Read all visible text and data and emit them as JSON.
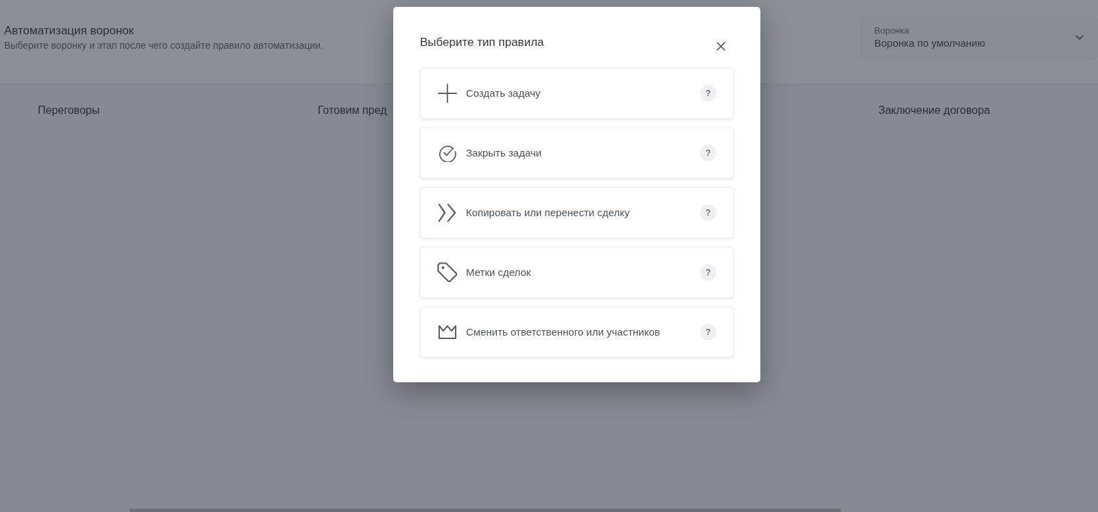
{
  "header": {
    "title": "Автоматизация воронок",
    "subtitle": "Выберите воронку и этап после чего создайте правило автоматизации."
  },
  "funnel_select": {
    "label": "Воронка",
    "value": "Воронка по умолчанию"
  },
  "stages": [
    {
      "title": "Переговоры"
    },
    {
      "title": "Готовим пред"
    },
    {
      "title": "Заключение договора"
    }
  ],
  "modal": {
    "title": "Выберите тип правила",
    "options": [
      {
        "kind": "create-task",
        "label": "Создать задачу",
        "help": "?"
      },
      {
        "kind": "close-tasks",
        "label": "Закрыть задачи",
        "help": "?"
      },
      {
        "kind": "copy-move",
        "label": "Копировать или перенести сделку",
        "help": "?"
      },
      {
        "kind": "tags",
        "label": "Метки сделок",
        "help": "?"
      },
      {
        "kind": "change-owner",
        "label": "Сменить ответственного или участников",
        "help": "?"
      }
    ]
  }
}
